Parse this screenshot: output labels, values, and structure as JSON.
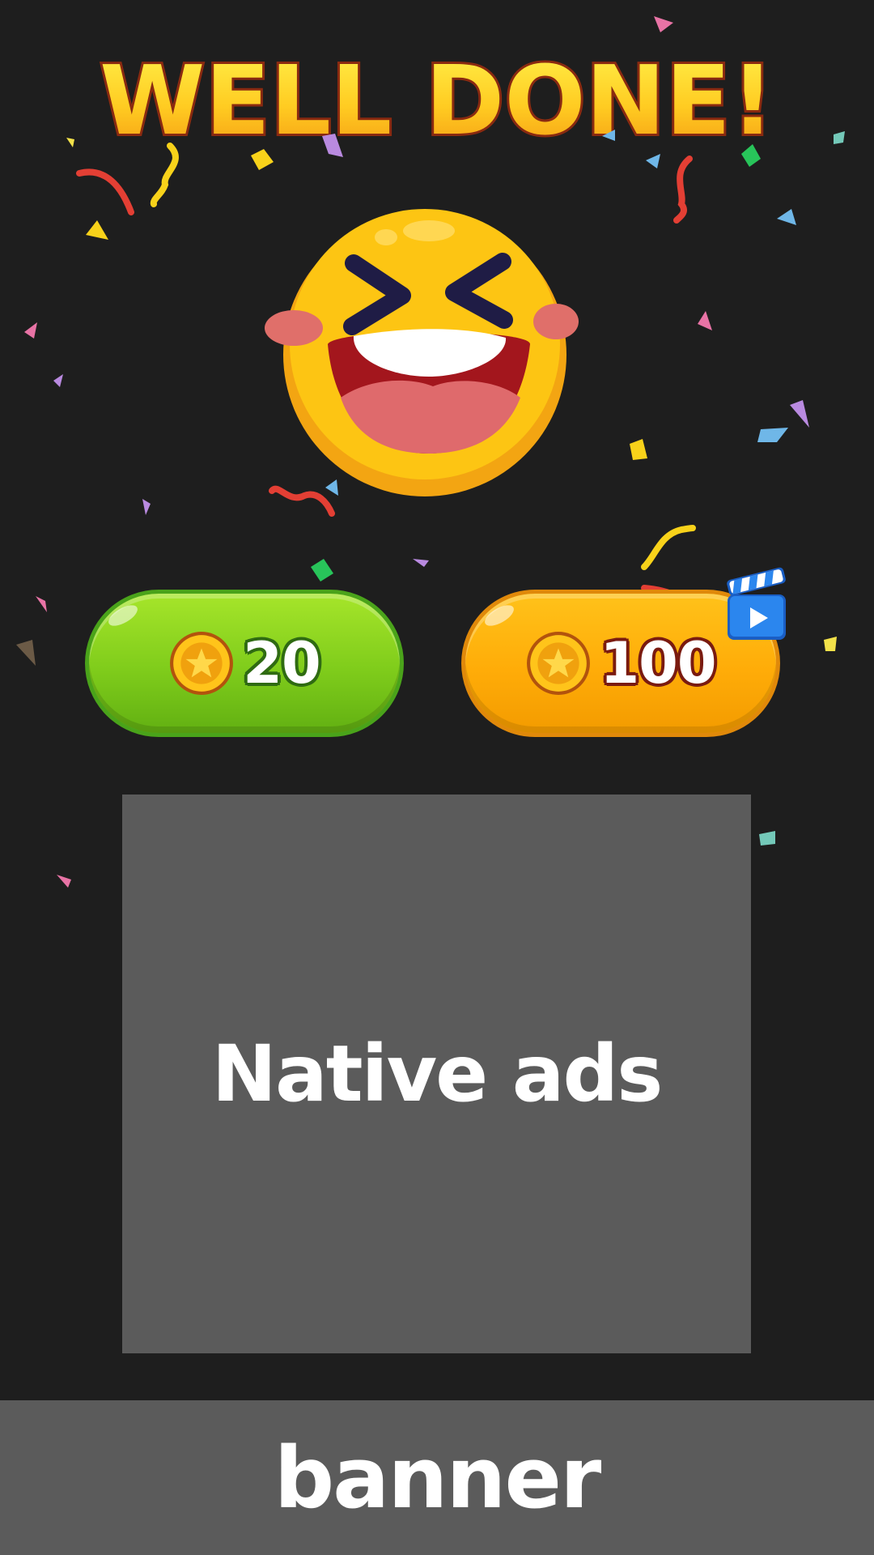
{
  "title": "WELL DONE!",
  "rewards": {
    "claim": {
      "amount": "20",
      "icon": "coin-icon"
    },
    "video_claim": {
      "amount": "100",
      "icon": "coin-icon",
      "badge_icon": "video-clapperboard-icon"
    }
  },
  "native_ads": {
    "label": "Native ads"
  },
  "banner": {
    "label": "banner"
  },
  "colors": {
    "background": "#1e1e1e",
    "green_button": "#7fcc1b",
    "orange_button": "#ffac08",
    "placeholder": "#5b5b5b",
    "title_gold": "#ffc21a"
  }
}
